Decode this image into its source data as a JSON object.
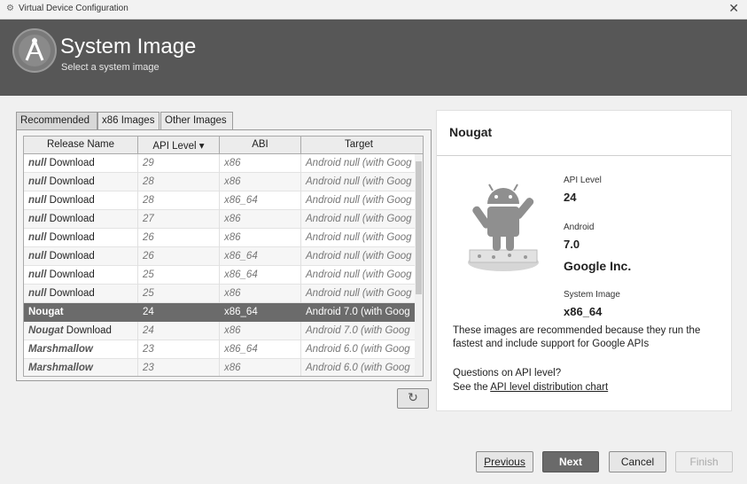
{
  "window": {
    "title": "Virtual Device Configuration"
  },
  "header": {
    "title": "System Image",
    "subtitle": "Select a system image"
  },
  "tabs": [
    "Recommended",
    "x86 Images",
    "Other Images"
  ],
  "table": {
    "columns": [
      "Release Name",
      "API Level ▾",
      "ABI",
      "Target"
    ],
    "rows": [
      {
        "name_em": "null",
        "name": " Download",
        "api": "29",
        "abi": "x86",
        "target": "Android null (with Goog"
      },
      {
        "name_em": "null",
        "name": " Download",
        "api": "28",
        "abi": "x86",
        "target": "Android null (with Goog"
      },
      {
        "name_em": "null",
        "name": " Download",
        "api": "28",
        "abi": "x86_64",
        "target": "Android null (with Goog"
      },
      {
        "name_em": "null",
        "name": " Download",
        "api": "27",
        "abi": "x86",
        "target": "Android null (with Goog"
      },
      {
        "name_em": "null",
        "name": " Download",
        "api": "26",
        "abi": "x86",
        "target": "Android null (with Goog"
      },
      {
        "name_em": "null",
        "name": " Download",
        "api": "26",
        "abi": "x86_64",
        "target": "Android null (with Goog"
      },
      {
        "name_em": "null",
        "name": " Download",
        "api": "25",
        "abi": "x86_64",
        "target": "Android null (with Goog"
      },
      {
        "name_em": "null",
        "name": " Download",
        "api": "25",
        "abi": "x86",
        "target": "Android null (with Goog"
      },
      {
        "name_em": "Nougat",
        "name": "",
        "api": "24",
        "abi": "x86_64",
        "target": "Android 7.0 (with Goog"
      },
      {
        "name_em": "Nougat",
        "name": " Download",
        "api": "24",
        "abi": "x86",
        "target": "Android 7.0 (with Goog"
      },
      {
        "name_em": "Marshmallow",
        "name": "",
        "api": "23",
        "abi": "x86_64",
        "target": "Android 6.0 (with Goog"
      },
      {
        "name_em": "Marshmallow",
        "name": "",
        "api": "23",
        "abi": "x86",
        "target": "Android 6.0 (with Goog"
      }
    ],
    "selected_index": 8
  },
  "details": {
    "title": "Nougat",
    "api_label": "API Level",
    "api_value": "24",
    "android_label": "Android",
    "android_value": "7.0",
    "vendor": "Google Inc.",
    "image_label": "System Image",
    "image_value": "x86_64",
    "note": "These images are recommended because they run the fastest and include support for Google APIs",
    "question": "Questions on API level?",
    "see_prefix": "See the ",
    "see_link": "API level distribution chart"
  },
  "buttons": {
    "refresh_glyph": "↻",
    "previous": "Previous",
    "next": "Next",
    "cancel": "Cancel",
    "finish": "Finish"
  },
  "icons": {
    "app": "android-studio-icon",
    "close": "close-icon",
    "refresh": "refresh-icon"
  }
}
